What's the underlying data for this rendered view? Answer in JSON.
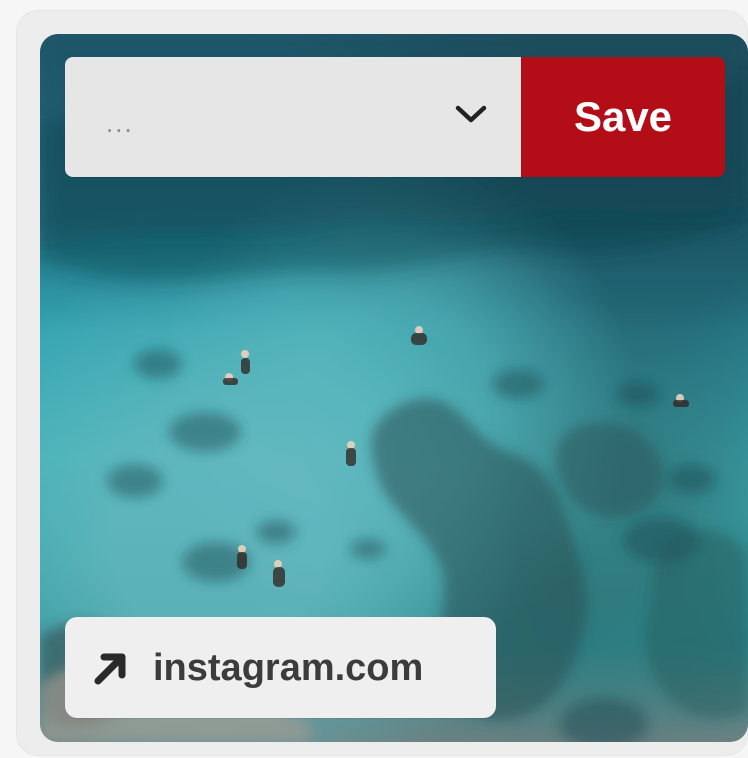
{
  "pin": {
    "board_selector": {
      "value": "...",
      "icon": "chevron-down-icon"
    },
    "save_label": "Save",
    "source_link": {
      "label": "instagram.com",
      "icon": "arrow-up-right-icon"
    }
  },
  "colors": {
    "save_button": "#b30d17",
    "selector_background": "#e6e6e6",
    "link_background": "#efefef",
    "page_background": "#f6f6f6"
  }
}
